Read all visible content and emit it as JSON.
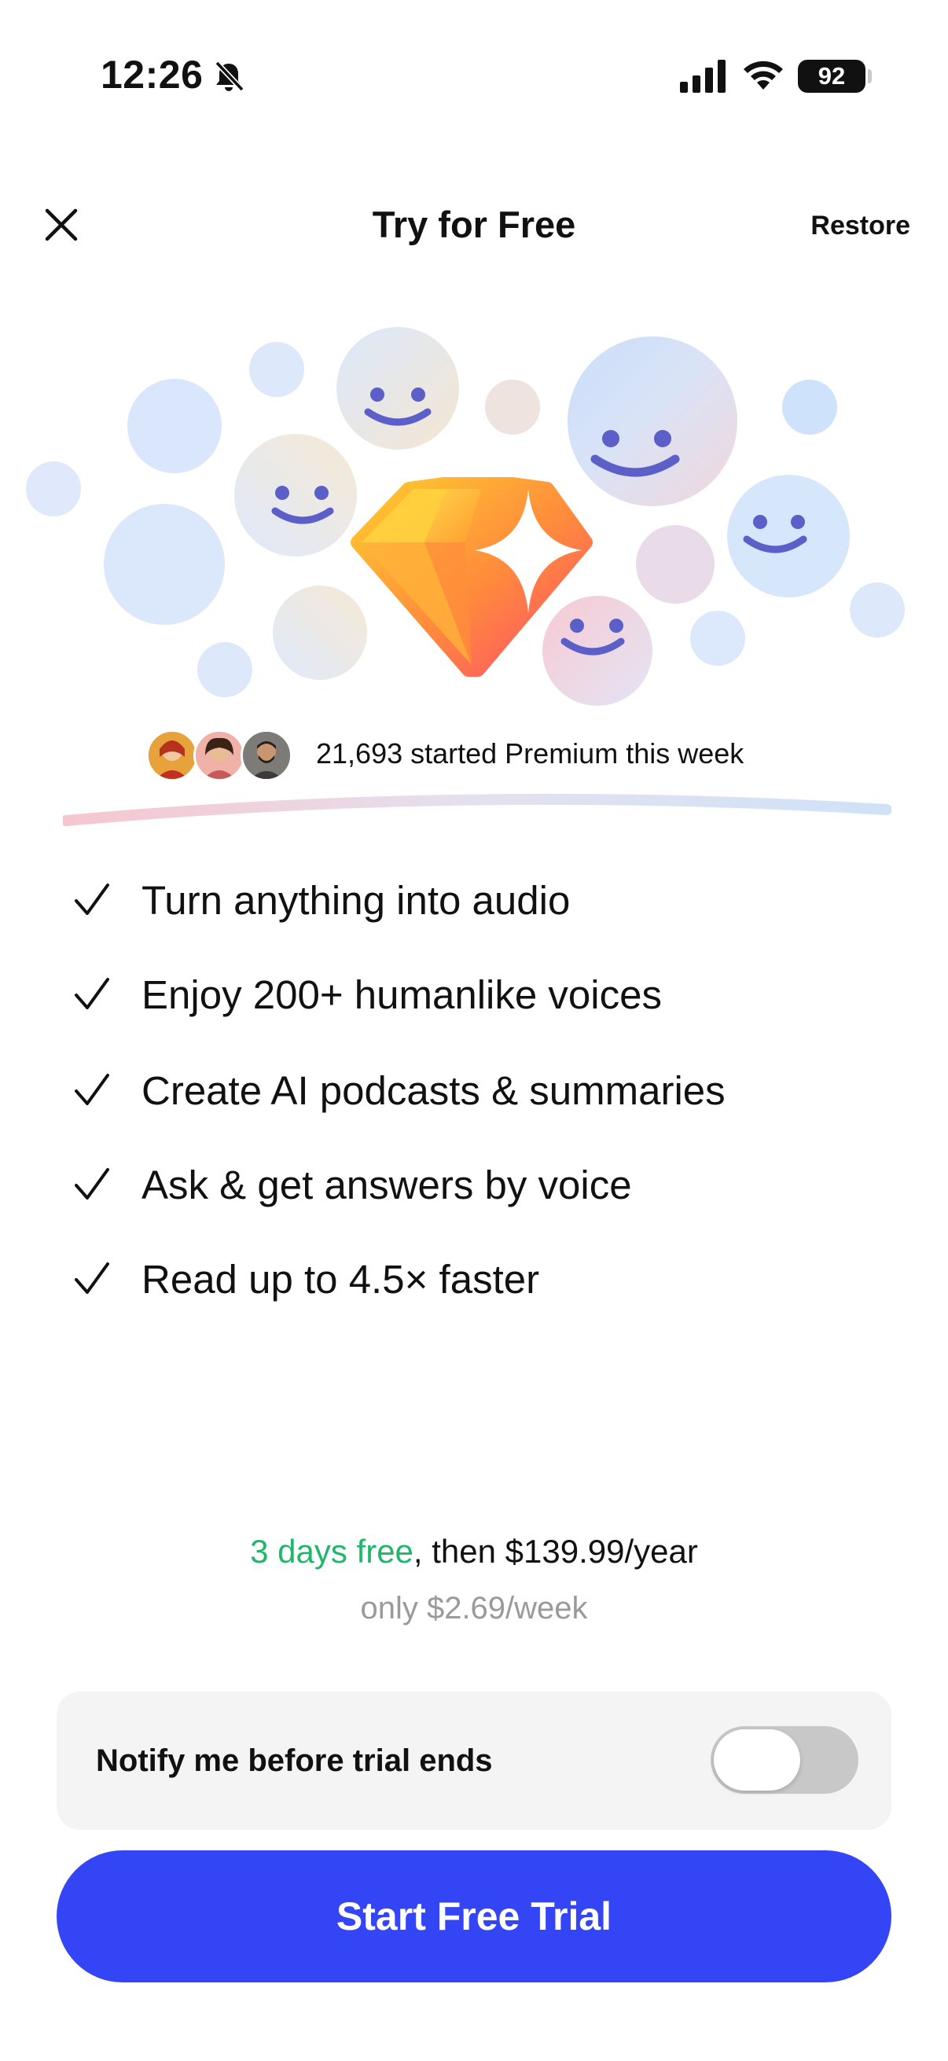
{
  "status_bar": {
    "time": "12:26",
    "battery": "92",
    "icons": [
      "bell-slash-icon",
      "cellular-signal-icon",
      "wifi-icon",
      "battery-icon"
    ]
  },
  "nav": {
    "close_icon": "close-icon",
    "title": "Try for Free",
    "restore_label": "Restore"
  },
  "hero": {
    "icon": "diamond-sparkle-icon",
    "decoration": "smiley-bubbles"
  },
  "social_proof": {
    "text": "21,693 started Premium this week"
  },
  "features": [
    {
      "icon": "checkmark-icon",
      "label": "Turn anything into audio"
    },
    {
      "icon": "checkmark-icon",
      "label": "Enjoy 200+ humanlike voices"
    },
    {
      "icon": "checkmark-icon",
      "label": "Create AI podcasts & summaries"
    },
    {
      "icon": "checkmark-icon",
      "label": "Ask & get answers by voice"
    },
    {
      "icon": "checkmark-icon",
      "label": "Read up to 4.5× faster"
    }
  ],
  "pricing": {
    "trial_text": "3 days free",
    "then_text": ", then $139.99/year",
    "weekly_text": "only $2.69/week"
  },
  "notify": {
    "label": "Notify me before trial ends",
    "enabled": false
  },
  "cta": {
    "label": "Start Free Trial"
  },
  "colors": {
    "accent": "#3345f5",
    "trial_green": "#1fb86b",
    "muted_text": "#9a9a9a",
    "card_bg": "#f4f4f5",
    "toggle_off": "#c8c8c8",
    "smile": "#5b5fc7"
  }
}
